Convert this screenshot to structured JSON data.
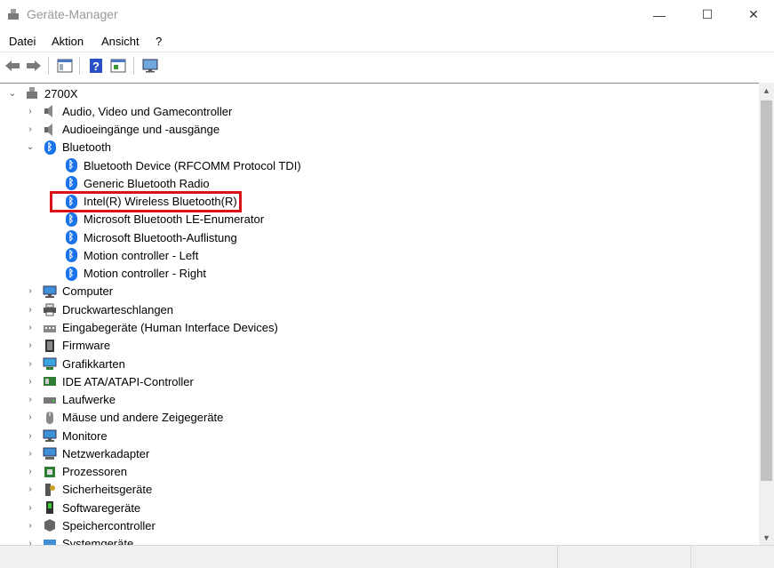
{
  "window": {
    "title": "Geräte-Manager",
    "controls": {
      "minimize": "—",
      "maximize": "☐",
      "close": "✕"
    }
  },
  "menu": [
    "Datei",
    "Aktion",
    "Ansicht",
    "?"
  ],
  "toolbar": {
    "icons": [
      "back-arrow-icon",
      "forward-arrow-icon",
      "show-hide-console-tree-icon",
      "help-icon",
      "properties-icon",
      "monitor-scan-icon"
    ]
  },
  "tree": {
    "root": "2700X",
    "categories": [
      {
        "label": "Audio, Video und Gamecontroller",
        "icon": "speaker-icon"
      },
      {
        "label": "Audioeingänge und -ausgänge",
        "icon": "speaker-icon"
      },
      {
        "label": "Bluetooth",
        "icon": "bluetooth-icon",
        "expanded": true,
        "children": [
          "Bluetooth Device (RFCOMM Protocol TDI)",
          "Generic Bluetooth Radio",
          "Intel(R) Wireless Bluetooth(R)",
          "Microsoft Bluetooth LE-Enumerator",
          "Microsoft Bluetooth-Auflistung",
          "Motion controller - Left",
          "Motion controller - Right"
        ]
      },
      {
        "label": "Computer",
        "icon": "computer-icon"
      },
      {
        "label": "Druckwarteschlangen",
        "icon": "printer-icon"
      },
      {
        "label": "Eingabegeräte (Human Interface Devices)",
        "icon": "hid-icon"
      },
      {
        "label": "Firmware",
        "icon": "firmware-icon"
      },
      {
        "label": "Grafikkarten",
        "icon": "display-adapter-icon"
      },
      {
        "label": "IDE ATA/ATAPI-Controller",
        "icon": "ide-controller-icon"
      },
      {
        "label": "Laufwerke",
        "icon": "disk-drive-icon"
      },
      {
        "label": "Mäuse und andere Zeigegeräte",
        "icon": "mouse-icon"
      },
      {
        "label": "Monitore",
        "icon": "monitor-icon"
      },
      {
        "label": "Netzwerkadapter",
        "icon": "network-adapter-icon"
      },
      {
        "label": "Prozessoren",
        "icon": "processor-icon"
      },
      {
        "label": "Sicherheitsgeräte",
        "icon": "security-device-icon"
      },
      {
        "label": "Softwaregeräte",
        "icon": "software-device-icon"
      },
      {
        "label": "Speichercontroller",
        "icon": "storage-controller-icon"
      },
      {
        "label": "Systemgeräte",
        "icon": "system-device-icon"
      }
    ]
  },
  "highlight": {
    "target": "Intel(R) Wireless Bluetooth(R)",
    "color": "#d9121a"
  },
  "colors": {
    "bluetooth": "#1a73e8",
    "highlight": "#d9121a"
  }
}
